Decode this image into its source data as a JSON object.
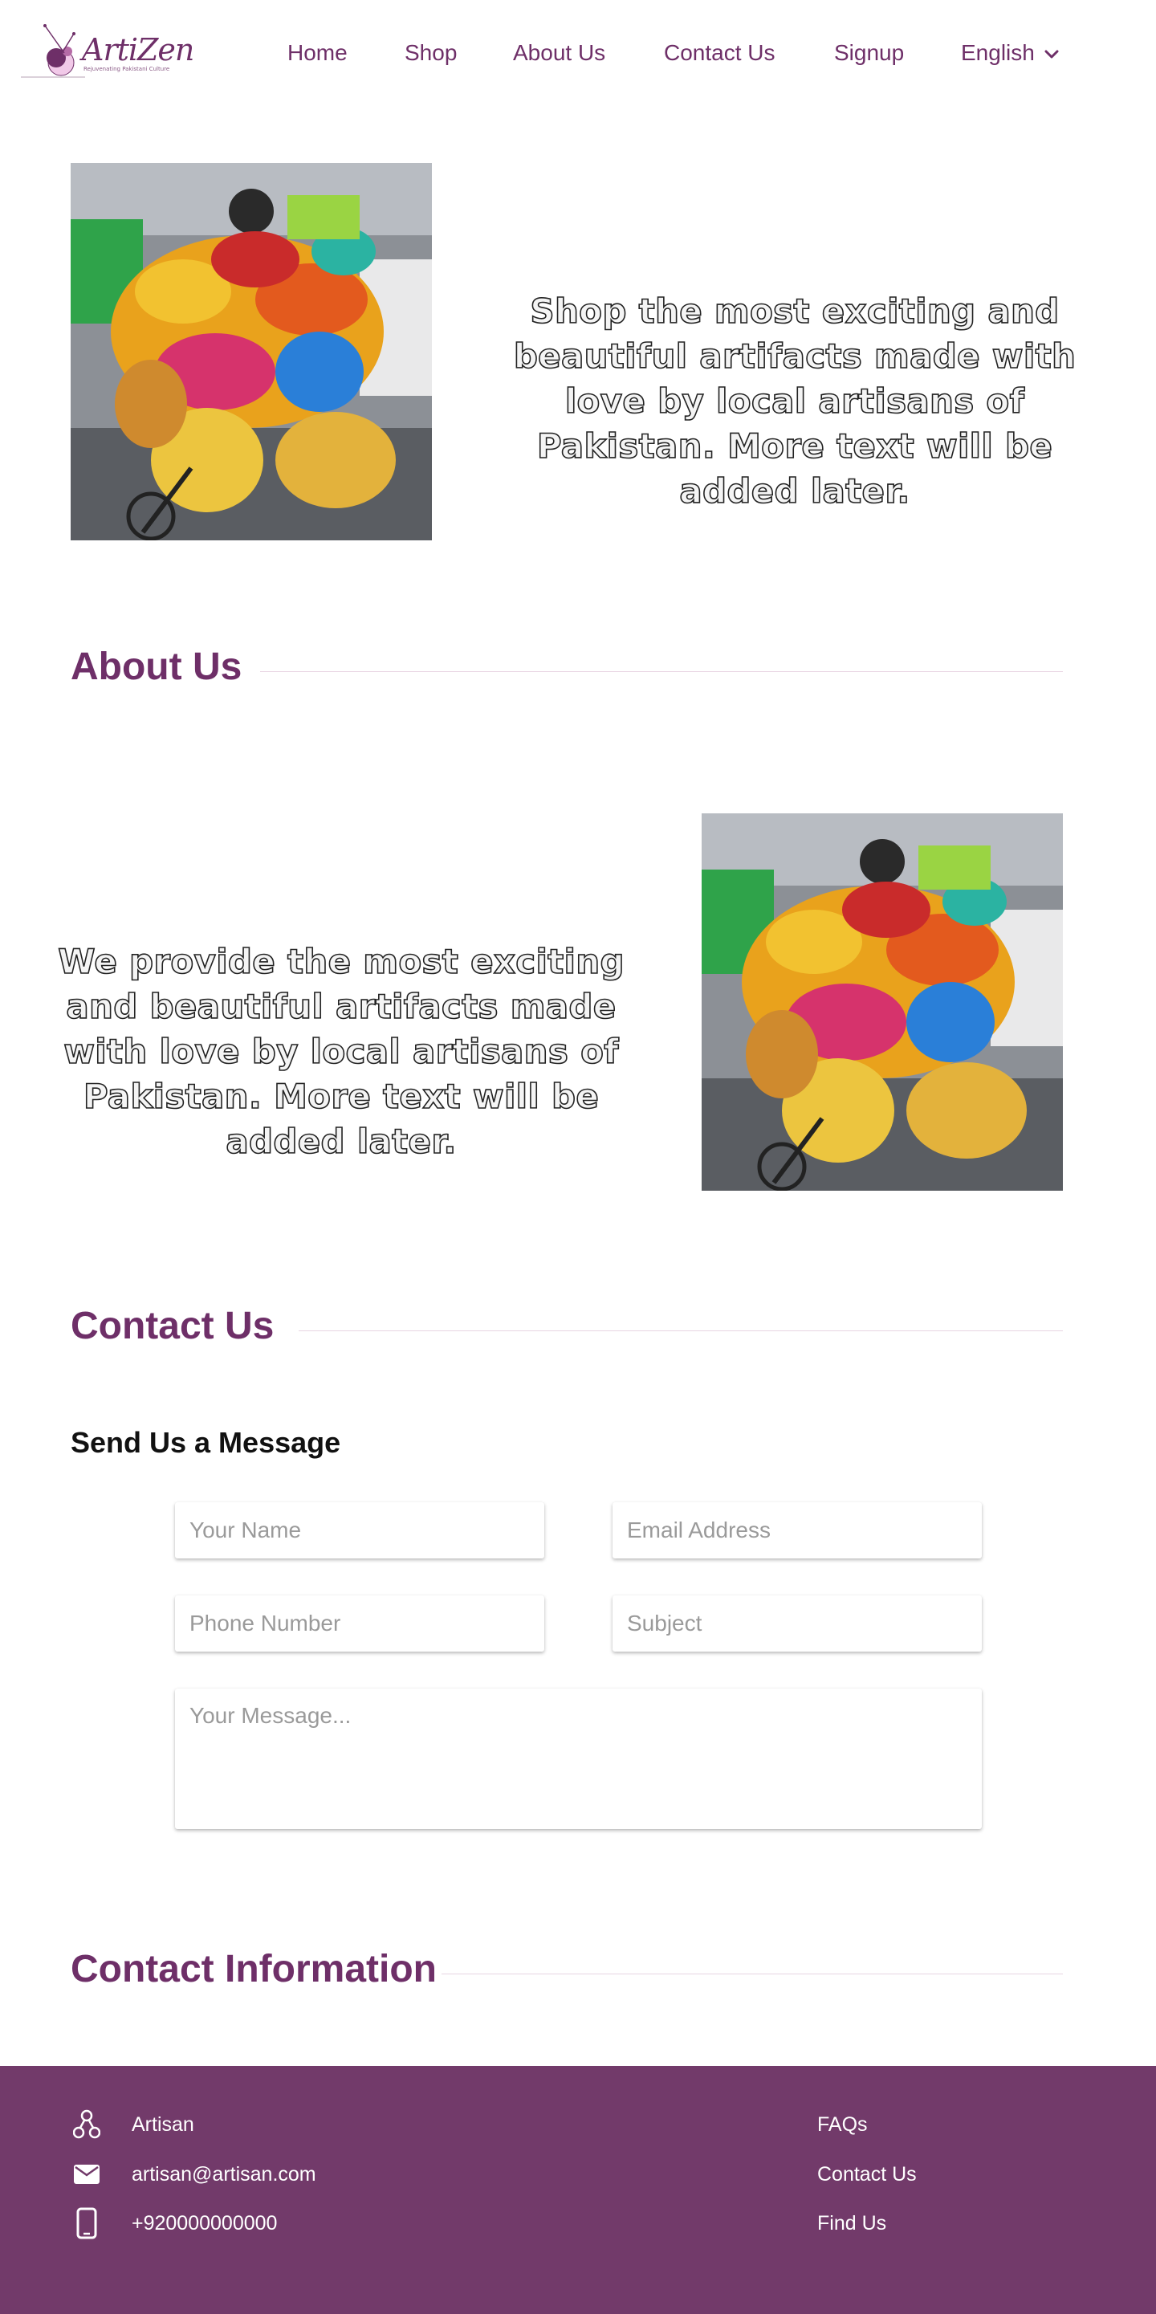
{
  "brand": {
    "name": "ArtiZen",
    "tagline": "Rejuvenating Pakistani Culture"
  },
  "nav": {
    "home": "Home",
    "shop": "Shop",
    "about": "About Us",
    "contact": "Contact Us",
    "signup": "Signup",
    "language": "English"
  },
  "hero": {
    "text": "Shop the most exciting and beautiful artifacts made with love by local artisans of Pakistan.  More text will be added later."
  },
  "about": {
    "heading": "About Us",
    "text": "We provide the most exciting and beautiful artifacts made with love by local artisans of Pakistan.  More text will be added later."
  },
  "contact": {
    "heading": "Contact Us",
    "form_heading": "Send Us a Message",
    "name_placeholder": "Your Name",
    "email_placeholder": "Email Address",
    "phone_placeholder": "Phone Number",
    "subject_placeholder": "Subject",
    "message_placeholder": "Your Message..."
  },
  "contact_info": {
    "heading": "Contact Information"
  },
  "footer": {
    "items": [
      {
        "icon": "artisan-icon",
        "text": "Artisan"
      },
      {
        "icon": "mail-icon",
        "text": "artisan@artisan.com"
      },
      {
        "icon": "phone-icon",
        "text": "+920000000000"
      }
    ],
    "links": [
      "FAQs",
      "Contact Us",
      "Find Us"
    ]
  },
  "colors": {
    "brand": "#6e2f68",
    "footer_bg": "#723a6a",
    "divider": "#e8d4e2"
  }
}
